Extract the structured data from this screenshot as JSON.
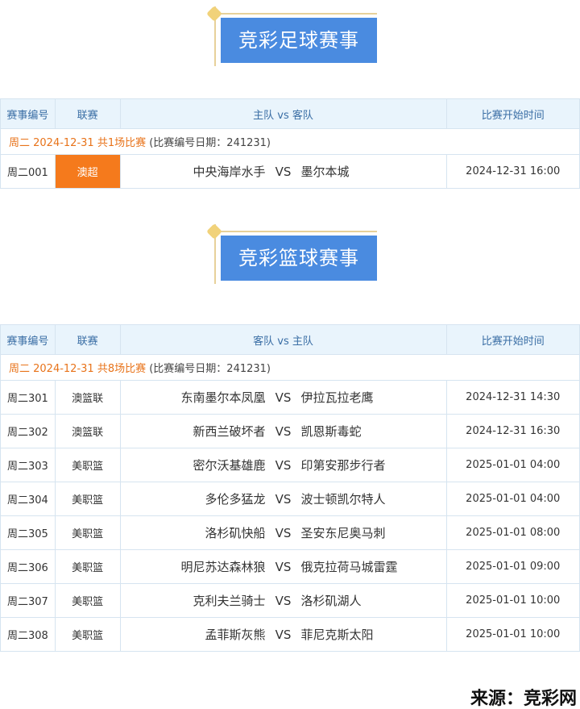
{
  "football": {
    "banner": "竞彩足球赛事",
    "headers": [
      "赛事编号",
      "联赛",
      "主队 vs 客队",
      "比赛开始时间"
    ],
    "date_line": {
      "highlight": "周二 2024-12-31 共1场比赛",
      "note": "(比赛编号日期：241231)"
    },
    "matches": [
      {
        "id": "周二001",
        "league": "澳超",
        "home": "中央海岸水手",
        "vs": "VS",
        "away": "墨尔本城",
        "time": "2024-12-31 16:00"
      }
    ]
  },
  "basketball": {
    "banner": "竞彩篮球赛事",
    "headers": [
      "赛事编号",
      "联赛",
      "客队 vs 主队",
      "比赛开始时间"
    ],
    "date_line": {
      "highlight": "周二 2024-12-31 共8场比赛",
      "note": "(比赛编号日期：241231)"
    },
    "matches": [
      {
        "id": "周二301",
        "league": "澳篮联",
        "home": "东南墨尔本凤凰",
        "vs": "VS",
        "away": "伊拉瓦拉老鹰",
        "time": "2024-12-31 14:30"
      },
      {
        "id": "周二302",
        "league": "澳篮联",
        "home": "新西兰破坏者",
        "vs": "VS",
        "away": "凯恩斯毒蛇",
        "time": "2024-12-31 16:30"
      },
      {
        "id": "周二303",
        "league": "美职篮",
        "home": "密尔沃基雄鹿",
        "vs": "VS",
        "away": "印第安那步行者",
        "time": "2025-01-01 04:00"
      },
      {
        "id": "周二304",
        "league": "美职篮",
        "home": "多伦多猛龙",
        "vs": "VS",
        "away": "波士顿凯尔特人",
        "time": "2025-01-01 04:00"
      },
      {
        "id": "周二305",
        "league": "美职篮",
        "home": "洛杉矶快船",
        "vs": "VS",
        "away": "圣安东尼奥马刺",
        "time": "2025-01-01 08:00"
      },
      {
        "id": "周二306",
        "league": "美职篮",
        "home": "明尼苏达森林狼",
        "vs": "VS",
        "away": "俄克拉荷马城雷霆",
        "time": "2025-01-01 09:00"
      },
      {
        "id": "周二307",
        "league": "美职篮",
        "home": "克利夫兰骑士",
        "vs": "VS",
        "away": "洛杉矶湖人",
        "time": "2025-01-01 10:00"
      },
      {
        "id": "周二308",
        "league": "美职篮",
        "home": "孟菲斯灰熊",
        "vs": "VS",
        "away": "菲尼克斯太阳",
        "time": "2025-01-01 10:00"
      }
    ]
  },
  "source": "来源：竞彩网",
  "colors": {
    "banner_blue": "#4a8be0",
    "league_orange": "#f57a1c",
    "date_orange": "#e8731a",
    "header_bg": "#e9f4fc"
  }
}
